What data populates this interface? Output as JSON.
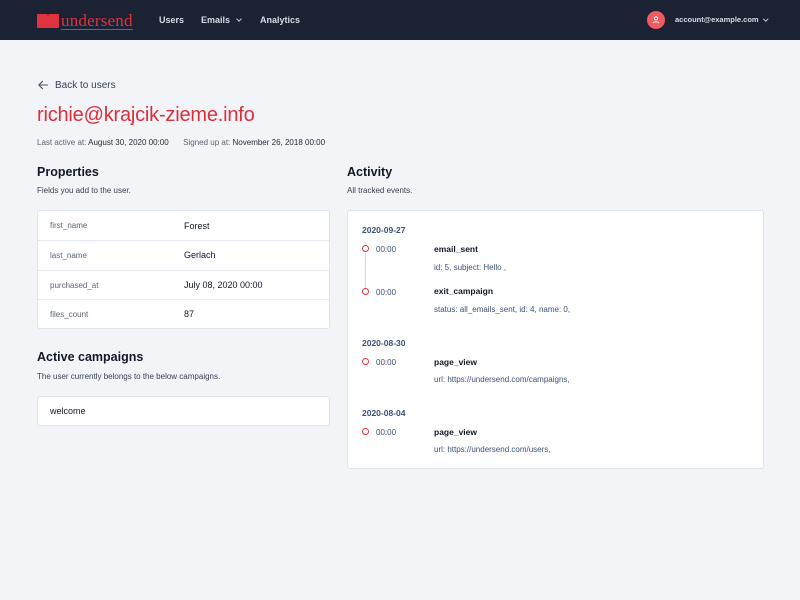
{
  "nav": {
    "logo_under": "under",
    "logo_send": "send",
    "links": [
      "Users",
      "Emails",
      "Analytics"
    ],
    "account": "account@example.com"
  },
  "header": {
    "back_label": "Back to users",
    "title": "richie@krajcik-zieme.info",
    "last_active_label": "Last active at:",
    "last_active_value": "August 30, 2020 00:00",
    "signed_up_label": "Signed up at:",
    "signed_up_value": "November 26, 2018 00:00"
  },
  "properties": {
    "title": "Properties",
    "subtitle": "Fields you add to the user.",
    "rows": [
      {
        "key": "first_name",
        "value": "Forest"
      },
      {
        "key": "last_name",
        "value": "Gerlach"
      },
      {
        "key": "purchased_at",
        "value": "July 08, 2020 00:00"
      },
      {
        "key": "files_count",
        "value": "87"
      }
    ]
  },
  "campaigns": {
    "title": "Active campaigns",
    "subtitle": "The user currently belongs to the below campaigns.",
    "items": [
      "welcome"
    ]
  },
  "activity": {
    "title": "Activity",
    "subtitle": "All tracked events.",
    "groups": [
      {
        "date": "2020-09-27",
        "events": [
          {
            "time": "00:00",
            "name": "email_sent",
            "detail": "id: 5, subject: Hello ,"
          },
          {
            "time": "00:00",
            "name": "exit_campaign",
            "detail": "status: all_emails_sent, id: 4, name: 0,"
          }
        ]
      },
      {
        "date": "2020-08-30",
        "events": [
          {
            "time": "00:00",
            "name": "page_view",
            "detail": "url: https://undersend.com/campaigns,"
          }
        ]
      },
      {
        "date": "2020-08-04",
        "events": [
          {
            "time": "00:00",
            "name": "page_view",
            "detail": "url: https://undersend.com/users,"
          }
        ]
      }
    ]
  },
  "colors": {
    "brand": "#e0333f",
    "nav_bg": "#1a2233",
    "page_bg": "#f3f4f8"
  },
  "icons": {
    "logo": "envelope-icon",
    "back": "arrow-left-icon",
    "avatar": "user-icon",
    "dropdown": "chevron-down-icon"
  }
}
